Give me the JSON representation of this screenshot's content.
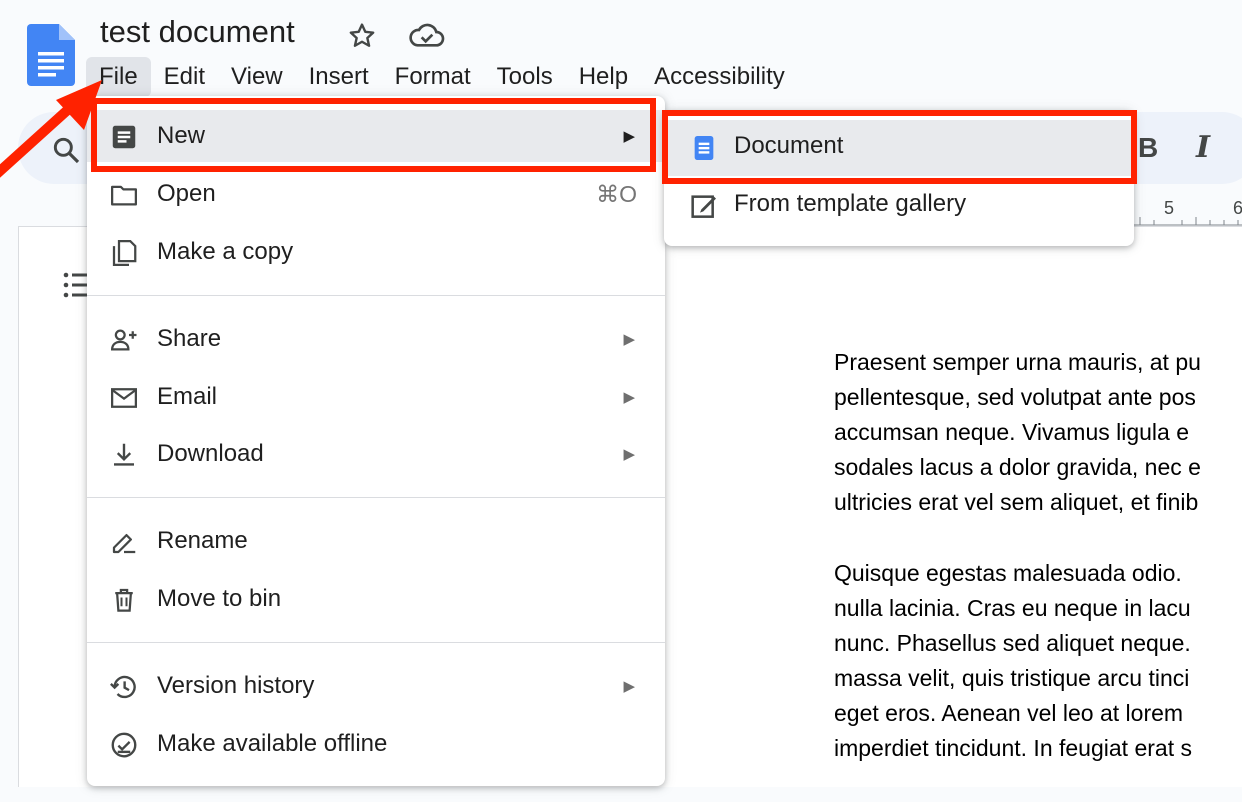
{
  "app": {
    "doc_title": "test document",
    "icons": {
      "logo": "google-docs-logo-icon",
      "star": "star-icon",
      "cloud": "cloud-saved-icon"
    }
  },
  "menu_bar": [
    "File",
    "Edit",
    "View",
    "Insert",
    "Format",
    "Tools",
    "Help",
    "Accessibility"
  ],
  "active_menu": "File",
  "toolbar": {
    "search_icon": "search-icon",
    "bold_label": "B",
    "italic_label": "I"
  },
  "ruler": {
    "labels": [
      "5",
      "6"
    ]
  },
  "file_menu": {
    "new_label": "New",
    "open_label": "Open",
    "open_shortcut": "⌘O",
    "copy_label": "Make a copy",
    "share_label": "Share",
    "email_label": "Email",
    "download_label": "Download",
    "rename_label": "Rename",
    "bin_label": "Move to bin",
    "history_label": "Version history",
    "offline_label": "Make available offline"
  },
  "new_submenu": {
    "document_label": "Document",
    "template_label": "From template gallery"
  },
  "document_body": {
    "paragraphs": [
      [
        "Praesent semper urna mauris, at pu",
        "pellentesque, sed volutpat ante pos",
        "accumsan neque. Vivamus ligula e",
        "sodales lacus a dolor gravida, nec e",
        "ultricies erat vel sem aliquet, et finib"
      ],
      [
        "Quisque egestas malesuada odio.",
        "nulla lacinia. Cras eu neque in lacu",
        "nunc. Phasellus sed aliquet neque.",
        "massa velit, quis tristique arcu tinci",
        "eget eros. Aenean vel leo at lorem",
        "imperdiet tincidunt. In feugiat erat s"
      ]
    ]
  },
  "annotation_color": "#ff2200",
  "accent_color": "#4285f4"
}
